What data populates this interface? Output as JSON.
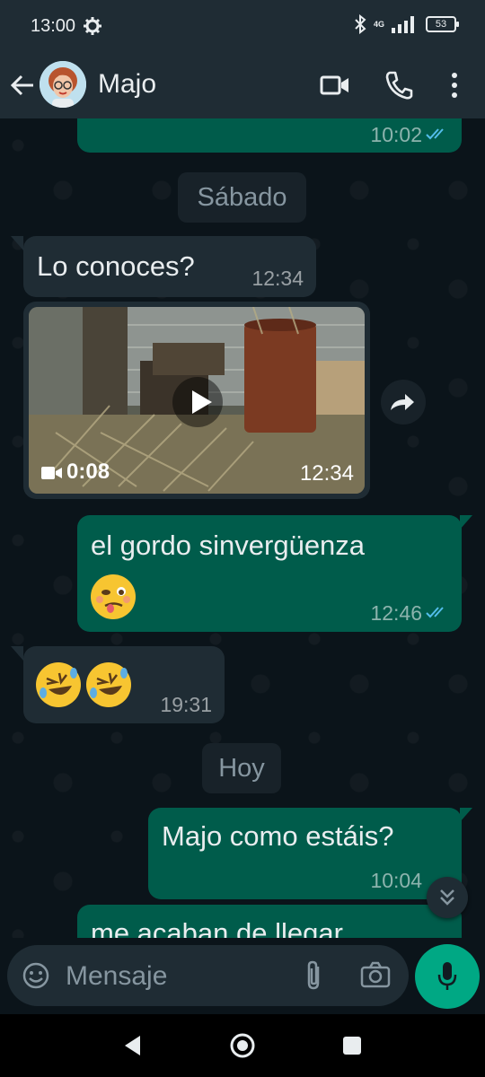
{
  "status_bar": {
    "time": "13:00",
    "network": "4G",
    "battery": "53"
  },
  "header": {
    "contact_name": "Majo",
    "icons": [
      "back-arrow-icon",
      "video-call-icon",
      "phone-icon",
      "more-vert-icon"
    ]
  },
  "messages": [
    {
      "type": "outgoing",
      "time": "10:02",
      "status": "read"
    },
    {
      "type": "date",
      "label": "Sábado"
    },
    {
      "type": "incoming",
      "text": "Lo conoces?",
      "time": "12:34"
    },
    {
      "type": "incoming_video",
      "duration": "0:08",
      "time": "12:34"
    },
    {
      "type": "outgoing",
      "text": "el gordo sinvergüenza",
      "emoji": "woozy-face",
      "time": "12:46",
      "status": "read"
    },
    {
      "type": "incoming",
      "emoji": [
        "rolling-on-floor-laughing",
        "rolling-on-floor-laughing"
      ],
      "time": "19:31"
    },
    {
      "type": "date",
      "label": "Hoy"
    },
    {
      "type": "outgoing",
      "text": "Majo como estáis?",
      "time": "10:04"
    },
    {
      "type": "outgoing",
      "text": "me acaban de llegar"
    }
  ],
  "input": {
    "placeholder": "Mensaje"
  },
  "colors": {
    "outgoing_bubble": "#005c4b",
    "incoming_bubble": "#1f2c34",
    "accent": "#00a884",
    "read_ticks": "#53bdeb"
  }
}
